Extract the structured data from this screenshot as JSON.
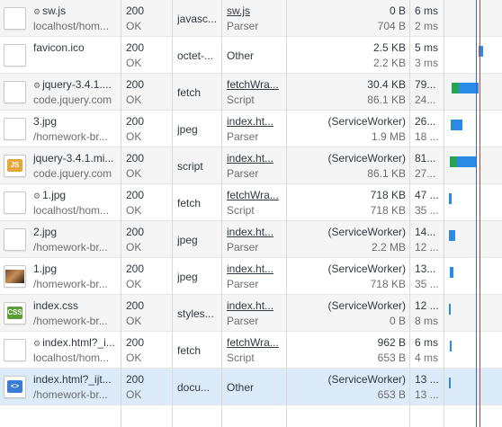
{
  "rows": [
    {
      "icon": "blank",
      "gear": true,
      "name": "sw.js",
      "host": "localhost/hom...",
      "status": "200",
      "status_text": "OK",
      "type": "javasc...",
      "initiator": "sw.js",
      "initiator_link": true,
      "initiator_sub": "Parser",
      "size": "0 B",
      "size_sub": "704 B",
      "time": "6 ms",
      "time_sub": "2 ms",
      "bar": {
        "wait": 0,
        "dl": 0
      },
      "state": "alt"
    },
    {
      "icon": "blank",
      "gear": false,
      "name": "favicon.ico",
      "host": "",
      "status": "200",
      "status_text": "OK",
      "type": "octet-...",
      "initiator": "Other",
      "initiator_link": false,
      "initiator_sub": "",
      "size": "2.5 KB",
      "size_sub": "2.2 KB",
      "time": "5 ms",
      "time_sub": "3 ms",
      "bar": {
        "wait": 0,
        "dl": 5
      },
      "state": "white"
    },
    {
      "icon": "blank",
      "gear": true,
      "name": "jquery-3.4.1....",
      "host": "code.jquery.com",
      "status": "200",
      "status_text": "OK",
      "type": "fetch",
      "initiator": "fetchWra...",
      "initiator_link": true,
      "initiator_sub": "Script",
      "size": "30.4 KB",
      "size_sub": "86.1 KB",
      "time": "79...",
      "time_sub": "24...",
      "bar": {
        "wait": 8,
        "dl": 22
      },
      "state": "alt"
    },
    {
      "icon": "blank",
      "gear": false,
      "name": "3.jpg",
      "host": "/homework-br...",
      "status": "200",
      "status_text": "OK",
      "type": "jpeg",
      "initiator": "index.ht...",
      "initiator_link": true,
      "initiator_sub": "Parser",
      "size": "(ServiceWorker)",
      "size_sub": "1.9 MB",
      "time": "26...",
      "time_sub": "18 ...",
      "bar": {
        "wait": 1,
        "dl": 12
      },
      "state": "white"
    },
    {
      "icon": "js",
      "gear": false,
      "name": "jquery-3.4.1.mi...",
      "host": "code.jquery.com",
      "status": "200",
      "status_text": "OK",
      "type": "script",
      "initiator": "index.ht...",
      "initiator_link": true,
      "initiator_sub": "Parser",
      "size": "(ServiceWorker)",
      "size_sub": "86.1 KB",
      "time": "81...",
      "time_sub": "27...",
      "bar": {
        "wait": 8,
        "dl": 22
      },
      "state": "alt"
    },
    {
      "icon": "blank",
      "gear": true,
      "name": "1.jpg",
      "host": "localhost/hom...",
      "status": "200",
      "status_text": "OK",
      "type": "fetch",
      "initiator": "fetchWra...",
      "initiator_link": true,
      "initiator_sub": "Script",
      "size": "718 KB",
      "size_sub": "718 KB",
      "time": "47 ...",
      "time_sub": "35 ...",
      "bar": {
        "wait": 0,
        "dl": 3
      },
      "state": "white"
    },
    {
      "icon": "blank",
      "gear": false,
      "name": "2.jpg",
      "host": "/homework-br...",
      "status": "200",
      "status_text": "OK",
      "type": "jpeg",
      "initiator": "index.ht...",
      "initiator_link": true,
      "initiator_sub": "Parser",
      "size": "(ServiceWorker)",
      "size_sub": "2.2 MB",
      "time": "14...",
      "time_sub": "12 ...",
      "bar": {
        "wait": 0,
        "dl": 7
      },
      "state": "alt"
    },
    {
      "icon": "photo",
      "gear": false,
      "name": "1.jpg",
      "host": "/homework-br...",
      "status": "200",
      "status_text": "OK",
      "type": "jpeg",
      "initiator": "index.ht...",
      "initiator_link": true,
      "initiator_sub": "Parser",
      "size": "(ServiceWorker)",
      "size_sub": "718 KB",
      "time": "13...",
      "time_sub": "35 ...",
      "bar": {
        "wait": 0,
        "dl": 4
      },
      "state": "white"
    },
    {
      "icon": "css",
      "gear": false,
      "name": "index.css",
      "host": "/homework-br...",
      "status": "200",
      "status_text": "OK",
      "type": "styles...",
      "initiator": "index.ht...",
      "initiator_link": true,
      "initiator_sub": "Parser",
      "size": "(ServiceWorker)",
      "size_sub": "0 B",
      "time": "12 ...",
      "time_sub": "8 ms",
      "bar": {
        "wait": 0,
        "dl": 2
      },
      "state": "alt"
    },
    {
      "icon": "blank",
      "gear": true,
      "name": "index.html?_i...",
      "host": "localhost/hom...",
      "status": "200",
      "status_text": "OK",
      "type": "fetch",
      "initiator": "fetchWra...",
      "initiator_link": true,
      "initiator_sub": "Script",
      "size": "962 B",
      "size_sub": "653 B",
      "time": "6 ms",
      "time_sub": "4 ms",
      "bar": {
        "wait": 0,
        "dl": 2
      },
      "state": "white"
    },
    {
      "icon": "doc",
      "gear": false,
      "name": "index.html?_ijt...",
      "host": "/homework-br...",
      "status": "200",
      "status_text": "OK",
      "type": "docu...",
      "initiator": "Other",
      "initiator_link": false,
      "initiator_sub": "",
      "size": "(ServiceWorker)",
      "size_sub": "653 B",
      "time": "13 ...",
      "time_sub": "13 ...",
      "bar": {
        "wait": 0,
        "dl": 2
      },
      "state": "selected"
    }
  ],
  "icons": {
    "js": "JS",
    "css": "CSS",
    "doc": "<>"
  },
  "colors": {
    "waiting": "#27a353",
    "download": "#2b8ae6",
    "dom_content_loaded": "#3a68d8",
    "load": "#d03a3a",
    "selected": "#dcebfa"
  }
}
